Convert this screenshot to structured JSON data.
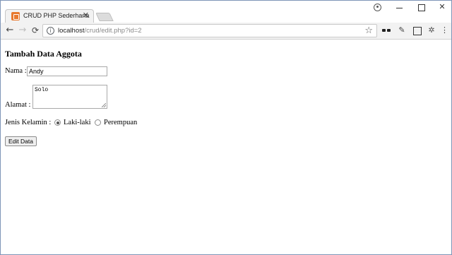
{
  "browser": {
    "tab_title": "CRUD PHP Sederhana",
    "tab_close_symbol": "✕",
    "close_window_symbol": "✕",
    "back_symbol": "←",
    "forward_symbol": "→",
    "reload_symbol": "C",
    "url_host": "localhost",
    "url_path": "/crud/edit.php?id=2",
    "star_symbol": "☆",
    "info_symbol": "i",
    "picker_symbol": "✎",
    "gear_symbol": "✲",
    "menu_symbol": "⋮",
    "icons": [
      "profile-icon",
      "minimize-icon",
      "maximize-icon",
      "close-icon",
      "back-arrow-icon",
      "forward-arrow-icon",
      "reload-icon",
      "info-icon",
      "star-icon",
      "glasses-extension-icon",
      "eyedropper-extension-icon",
      "capture-extension-icon",
      "gear-extension-icon",
      "menu-icon"
    ]
  },
  "page": {
    "title": "Tambah Data Aggota",
    "nama_label": "Nama :",
    "nama_value": "Andy",
    "alamat_label": "Alamat :",
    "alamat_value": "Solo",
    "jenis_kelamin_label": "Jenis Kelamin :",
    "options": [
      {
        "label": "Laki-laki",
        "checked": true
      },
      {
        "label": "Perempuan",
        "checked": false
      }
    ],
    "submit_label": "Edit Data"
  },
  "colors": {
    "favicon": "#e8792e",
    "frame_border": "#7e95b8"
  }
}
